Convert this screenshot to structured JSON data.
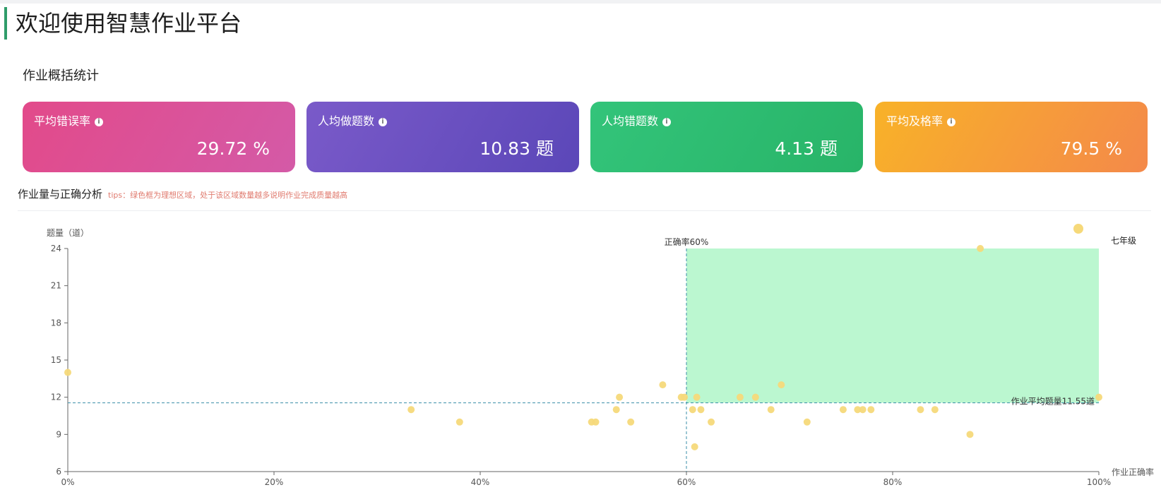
{
  "header": {
    "title": "欢迎使用智慧作业平台"
  },
  "overview": {
    "title": "作业概括统计",
    "cards": [
      {
        "label": "平均错误率",
        "value": "29.72",
        "unit": "%",
        "info_icon": "info-icon"
      },
      {
        "label": "人均做题数",
        "value": "10.83",
        "unit": "题",
        "info_icon": "info-icon"
      },
      {
        "label": "人均错题数",
        "value": "4.13",
        "unit": "题",
        "info_icon": "info-icon"
      },
      {
        "label": "平均及格率",
        "value": "79.5",
        "unit": "%",
        "info_icon": "info-icon"
      }
    ]
  },
  "analysis": {
    "title": "作业量与正确分析",
    "tip": "tips：绿色框为理想区域，处于该区域数量越多说明作业完成质量越高"
  },
  "colors": {
    "title_bar": "#2f9c6a",
    "ideal_area": "#bbf7d0",
    "point": "#f6d97a",
    "reference_line": "#3a8fa8"
  },
  "chart_data": {
    "type": "scatter",
    "ylabel": "题量（道）",
    "xlabel": "作业正确率",
    "x_ticks": [
      "0%",
      "20%",
      "40%",
      "60%",
      "80%",
      "100%"
    ],
    "y_ticks": [
      "6",
      "9",
      "12",
      "15",
      "18",
      "21",
      "24"
    ],
    "xlim": [
      0,
      100
    ],
    "ylim": [
      6,
      24
    ],
    "series": [
      {
        "name": "七年级",
        "points": [
          [
            0,
            14
          ],
          [
            33.3,
            11
          ],
          [
            38,
            10
          ],
          [
            50.8,
            10
          ],
          [
            51.2,
            10
          ],
          [
            53.2,
            11
          ],
          [
            53.5,
            12
          ],
          [
            54.6,
            10
          ],
          [
            57.7,
            13
          ],
          [
            59.5,
            12
          ],
          [
            59.8,
            12
          ],
          [
            60.6,
            11
          ],
          [
            60.8,
            8
          ],
          [
            61,
            12
          ],
          [
            61.4,
            11
          ],
          [
            62.4,
            10
          ],
          [
            65.2,
            12
          ],
          [
            66.7,
            12
          ],
          [
            68.2,
            11
          ],
          [
            69.2,
            13
          ],
          [
            71.7,
            10
          ],
          [
            75.2,
            11
          ],
          [
            76.6,
            11
          ],
          [
            77.1,
            11
          ],
          [
            77.9,
            11
          ],
          [
            82.7,
            11
          ],
          [
            84.1,
            11
          ],
          [
            87.5,
            9
          ],
          [
            88.5,
            24
          ],
          [
            100,
            12
          ]
        ]
      }
    ],
    "legend": {
      "position": "top-right",
      "marker_label": "七年级"
    },
    "reference_lines": [
      {
        "axis": "x",
        "value": 60,
        "label": "正确率60%"
      },
      {
        "axis": "y",
        "value": 11.55,
        "label": "作业平均题量11.55道"
      }
    ],
    "ideal_region": {
      "x": [
        60,
        100
      ],
      "y": [
        11.55,
        24
      ]
    }
  }
}
